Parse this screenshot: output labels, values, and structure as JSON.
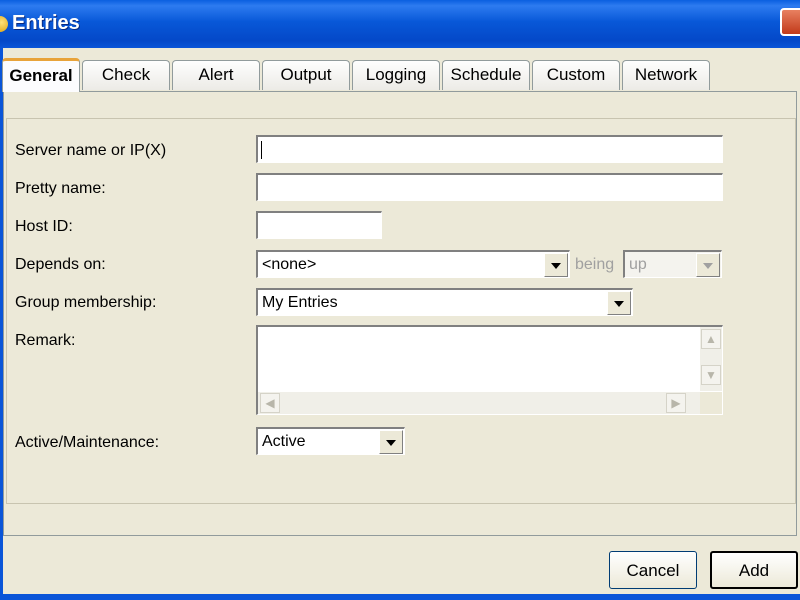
{
  "window": {
    "title": "Entries"
  },
  "tabs": [
    {
      "label": "General",
      "active": true
    },
    {
      "label": "Check",
      "active": false
    },
    {
      "label": "Alert",
      "active": false
    },
    {
      "label": "Output",
      "active": false
    },
    {
      "label": "Logging",
      "active": false
    },
    {
      "label": "Schedule",
      "active": false
    },
    {
      "label": "Custom",
      "active": false
    },
    {
      "label": "Network",
      "active": false
    }
  ],
  "form": {
    "server_label": "Server name or IP(X)",
    "server_value": "",
    "pretty_label": "Pretty name:",
    "pretty_value": "",
    "hostid_label": "Host ID:",
    "hostid_value": "",
    "depends_label": "Depends on:",
    "depends_value": "<none>",
    "being_label": "being",
    "being_value": "up",
    "group_label": "Group membership:",
    "group_value": "My Entries",
    "remark_label": "Remark:",
    "remark_value": "",
    "active_label": "Active/Maintenance:",
    "active_value": "Active"
  },
  "buttons": {
    "cancel": "Cancel",
    "add": "Add"
  },
  "icons": {
    "app": "app-icon",
    "close": "close-icon"
  }
}
